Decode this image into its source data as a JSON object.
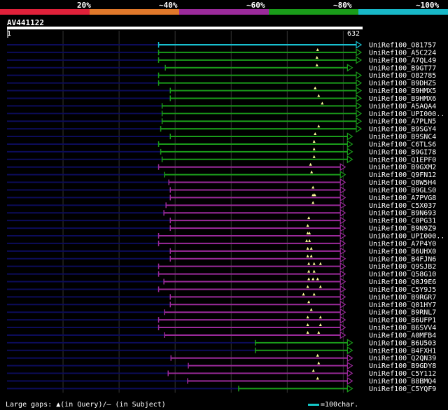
{
  "legend": [
    {
      "label": "20%",
      "color": "#e0213a"
    },
    {
      "label": "~40%",
      "color": "#e0782a"
    },
    {
      "label": "~60%",
      "color": "#9b2a9b"
    },
    {
      "label": "~80%",
      "color": "#1a9c1a"
    },
    {
      "label": "~100%",
      "color": "#18b8c8"
    }
  ],
  "query": {
    "name": "AV441122",
    "start": "1",
    "end": "632",
    "length": 632
  },
  "colors": {
    "cyan": "#18c0d0",
    "green": "#1a9c1a",
    "magenta": "#9b2a9b",
    "fade": "#0c0c5a",
    "grid": "#333333",
    "gap": "#ffff99"
  },
  "hits": [
    {
      "name": "UniRef100_O81757",
      "start": 0.428,
      "end": 1.0,
      "color": "cyan",
      "gaps": []
    },
    {
      "name": "UniRef100_A5C224",
      "start": 0.428,
      "end": 1.0,
      "color": "green",
      "gaps": [
        0.877
      ]
    },
    {
      "name": "UniRef100_A7QL49",
      "start": 0.428,
      "end": 1.0,
      "color": "green",
      "gaps": [
        0.875
      ]
    },
    {
      "name": "UniRef100_B9GT77",
      "start": 0.447,
      "end": 0.975,
      "color": "green",
      "gaps": [
        0.875
      ]
    },
    {
      "name": "UniRef100_O82785",
      "start": 0.428,
      "end": 1.0,
      "color": "green",
      "gaps": []
    },
    {
      "name": "UniRef100_B9DHZ5",
      "start": 0.428,
      "end": 1.0,
      "color": "green",
      "gaps": []
    },
    {
      "name": "UniRef100_B9HMX5",
      "start": 0.461,
      "end": 1.0,
      "color": "green",
      "gaps": [
        0.87
      ]
    },
    {
      "name": "UniRef100_B9HMX6",
      "start": 0.461,
      "end": 1.0,
      "color": "green",
      "gaps": [
        0.88
      ]
    },
    {
      "name": "UniRef100_A5AQA4",
      "start": 0.438,
      "end": 1.0,
      "color": "green",
      "gaps": [
        0.89
      ]
    },
    {
      "name": "UniRef100_UPI000..",
      "start": 0.438,
      "end": 1.0,
      "color": "green",
      "gaps": []
    },
    {
      "name": "UniRef100_A7PLN5",
      "start": 0.438,
      "end": 1.0,
      "color": "green",
      "gaps": []
    },
    {
      "name": "UniRef100_B9SGY4",
      "start": 0.434,
      "end": 1.0,
      "color": "green",
      "gaps": [
        0.88
      ]
    },
    {
      "name": "UniRef100_B9SNC4",
      "start": 0.461,
      "end": 0.975,
      "color": "green",
      "gaps": [
        0.87
      ]
    },
    {
      "name": "UniRef100_C6TLS6",
      "start": 0.428,
      "end": 0.975,
      "color": "green",
      "gaps": [
        0.867
      ]
    },
    {
      "name": "UniRef100_B9GI78",
      "start": 0.434,
      "end": 0.975,
      "color": "green",
      "gaps": [
        0.867
      ]
    },
    {
      "name": "UniRef100_Q1EPF0",
      "start": 0.438,
      "end": 0.975,
      "color": "green",
      "gaps": [
        0.867
      ]
    },
    {
      "name": "UniRef100_B9GXM2",
      "start": 0.428,
      "end": 0.955,
      "color": "magenta",
      "gaps": [
        0.857
      ]
    },
    {
      "name": "UniRef100_Q9FN12",
      "start": 0.445,
      "end": 0.955,
      "color": "green",
      "gaps": [
        0.86
      ]
    },
    {
      "name": "UniRef100_Q8W5H4",
      "start": 0.457,
      "end": 0.955,
      "color": "magenta",
      "gaps": []
    },
    {
      "name": "UniRef100_B9GLS0",
      "start": 0.461,
      "end": 0.955,
      "color": "magenta",
      "gaps": [
        0.864
      ]
    },
    {
      "name": "UniRef100_A7PVG8",
      "start": 0.461,
      "end": 0.955,
      "color": "magenta",
      "gaps": [
        0.864,
        0.869
      ]
    },
    {
      "name": "UniRef100_C5X037",
      "start": 0.449,
      "end": 0.955,
      "color": "magenta",
      "gaps": [
        0.864
      ]
    },
    {
      "name": "UniRef100_B9N693",
      "start": 0.443,
      "end": 0.955,
      "color": "magenta",
      "gaps": []
    },
    {
      "name": "UniRef100_C0PG31",
      "start": 0.461,
      "end": 0.955,
      "color": "magenta",
      "gaps": [
        0.852
      ]
    },
    {
      "name": "UniRef100_B9N9Z9",
      "start": 0.461,
      "end": 0.955,
      "color": "magenta",
      "gaps": [
        0.849
      ]
    },
    {
      "name": "UniRef100_UPI000..",
      "start": 0.428,
      "end": 0.955,
      "color": "magenta",
      "gaps": [
        0.849,
        0.854
      ]
    },
    {
      "name": "UniRef100_A7P4Y0",
      "start": 0.428,
      "end": 0.955,
      "color": "magenta",
      "gaps": [
        0.846,
        0.854
      ]
    },
    {
      "name": "UniRef100_B6UHX0",
      "start": 0.461,
      "end": 0.955,
      "color": "magenta",
      "gaps": [
        0.849,
        0.859
      ]
    },
    {
      "name": "UniRef100_B4FJN6",
      "start": 0.461,
      "end": 0.955,
      "color": "magenta",
      "gaps": [
        0.849,
        0.859
      ]
    },
    {
      "name": "UniRef100_Q9SJB2",
      "start": 0.428,
      "end": 0.955,
      "color": "magenta",
      "gaps": [
        0.852,
        0.867,
        0.885
      ]
    },
    {
      "name": "UniRef100_Q58G10",
      "start": 0.428,
      "end": 0.955,
      "color": "magenta",
      "gaps": [
        0.852,
        0.867
      ]
    },
    {
      "name": "UniRef100_Q0J9E6",
      "start": 0.443,
      "end": 0.955,
      "color": "magenta",
      "gaps": [
        0.852,
        0.864,
        0.877
      ]
    },
    {
      "name": "UniRef100_C5Y9J5",
      "start": 0.428,
      "end": 0.955,
      "color": "magenta",
      "gaps": [
        0.849,
        0.885
      ]
    },
    {
      "name": "UniRef100_B9RGR7",
      "start": 0.461,
      "end": 0.955,
      "color": "magenta",
      "gaps": [
        0.837,
        0.867
      ]
    },
    {
      "name": "UniRef100_Q01HY7",
      "start": 0.461,
      "end": 0.955,
      "color": "magenta",
      "gaps": [
        0.852
      ]
    },
    {
      "name": "UniRef100_B9RNL7",
      "start": 0.445,
      "end": 0.955,
      "color": "magenta",
      "gaps": [
        0.859
      ]
    },
    {
      "name": "UniRef100_B6UFP1",
      "start": 0.428,
      "end": 0.955,
      "color": "magenta",
      "gaps": [
        0.849,
        0.885
      ]
    },
    {
      "name": "UniRef100_B6SVV4",
      "start": 0.428,
      "end": 0.955,
      "color": "magenta",
      "gaps": [
        0.849,
        0.885
      ]
    },
    {
      "name": "UniRef100_A0MFB4",
      "start": 0.445,
      "end": 0.955,
      "color": "magenta",
      "gaps": [
        0.849,
        0.88
      ]
    },
    {
      "name": "UniRef100_B6U503",
      "start": 0.701,
      "end": 0.975,
      "color": "green",
      "gaps": []
    },
    {
      "name": "UniRef100_B4FXH1",
      "start": 0.701,
      "end": 0.975,
      "color": "green",
      "gaps": []
    },
    {
      "name": "UniRef100_Q2QN39",
      "start": 0.463,
      "end": 0.975,
      "color": "magenta",
      "gaps": [
        0.877
      ]
    },
    {
      "name": "UniRef100_B9GDY8",
      "start": 0.512,
      "end": 0.975,
      "color": "magenta",
      "gaps": [
        0.88
      ]
    },
    {
      "name": "UniRef100_C5Y112",
      "start": 0.455,
      "end": 0.975,
      "color": "magenta",
      "gaps": [
        0.865
      ]
    },
    {
      "name": "UniRef100_B8BMQ4",
      "start": 0.51,
      "end": 0.975,
      "color": "magenta",
      "gaps": [
        0.877
      ]
    },
    {
      "name": "UniRef100_C5YQF9",
      "start": 0.654,
      "end": 0.975,
      "color": "green",
      "gaps": []
    }
  ],
  "footer": {
    "gaps_text": "Large gaps: ▲(in Query)/– (in Subject)",
    "scale_text": "=100char."
  }
}
